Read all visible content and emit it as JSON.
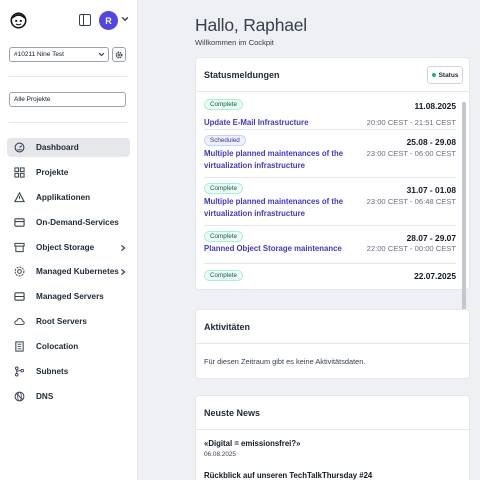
{
  "sidebar": {
    "avatar_initial": "R",
    "account_select": "#10211 Nine Test",
    "project_select": "Alle Projekte",
    "items": [
      {
        "label": "Dashboard",
        "icon": "dashboard-icon",
        "active": true
      },
      {
        "label": "Projekte",
        "icon": "projects-icon"
      },
      {
        "label": "Applikationen",
        "icon": "applications-icon"
      },
      {
        "label": "On-Demand-Services",
        "icon": "on-demand-icon"
      },
      {
        "label": "Object Storage",
        "icon": "object-storage-icon",
        "chevron": true
      },
      {
        "label": "Managed Kubernetes",
        "icon": "kubernetes-icon",
        "chevron": true
      },
      {
        "label": "Managed Servers",
        "icon": "managed-servers-icon"
      },
      {
        "label": "Root Servers",
        "icon": "cloud-icon"
      },
      {
        "label": "Colocation",
        "icon": "colocation-icon"
      },
      {
        "label": "Subnets",
        "icon": "subnets-icon"
      },
      {
        "label": "DNS",
        "icon": "dns-icon"
      }
    ]
  },
  "main": {
    "greeting": "Hallo, Raphael",
    "subtitle": "Willkommen im Cockpit",
    "status_card": {
      "title": "Statusmeldungen",
      "status_button": "Status",
      "items": [
        {
          "badge": "Complete",
          "title": "Update E-Mail Infrastructure",
          "date": "11.08.2025",
          "time": "20:00 CEST - 21:51 CEST"
        },
        {
          "badge": "Scheduled",
          "title": "Multiple planned maintenances of the virtualization infrastructure",
          "date": "25.08 - 29.08",
          "time": "23:00 CEST - 06:00 CEST"
        },
        {
          "badge": "Complete",
          "title": "Multiple planned maintenances of the virtualization infrastructure",
          "date": "31.07 - 01.08",
          "time": "23:00 CEST - 06:48 CEST"
        },
        {
          "badge": "Complete",
          "title": "Planned Object Storage maintenance",
          "date": "28.07 - 29.07",
          "time": "22:00 CEST - 00:00 CEST"
        },
        {
          "badge": "Complete",
          "title": "",
          "date": "22.07.2025",
          "time": ""
        }
      ]
    },
    "activity_card": {
      "title": "Aktivitäten",
      "empty": "Für diesen Zeitraum gibt es keine Aktivitätsdaten."
    },
    "news_card": {
      "title": "Neuste News",
      "items": [
        {
          "title": "«Digital = emissionsfrei?»",
          "date": "06.08.2025"
        },
        {
          "title": "Rückblick auf unseren TechTalkThursday #24",
          "date": ""
        }
      ]
    }
  },
  "colors": {
    "accent": "#4f46e5",
    "link": "#4338ca",
    "complete_bg": "#ecfdf5",
    "scheduled_bg": "#eef2ff"
  }
}
